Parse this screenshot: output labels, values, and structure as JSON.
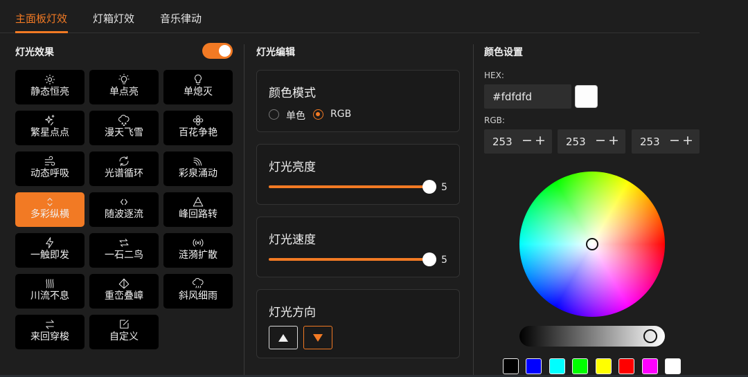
{
  "tabs": [
    {
      "label": "主面板灯效",
      "active": true
    },
    {
      "label": "灯箱灯效",
      "active": false
    },
    {
      "label": "音乐律动",
      "active": false
    }
  ],
  "effects_panel": {
    "title": "灯光效果",
    "toggle_on": true,
    "items": [
      {
        "label": "静态恒亮",
        "icon": "sun-icon"
      },
      {
        "label": "单点亮",
        "icon": "bulb-on-icon"
      },
      {
        "label": "单熄灭",
        "icon": "bulb-off-icon"
      },
      {
        "label": "繁星点点",
        "icon": "sparkle-icon"
      },
      {
        "label": "漫天飞雪",
        "icon": "snow-cloud-icon"
      },
      {
        "label": "百花争艳",
        "icon": "flower-icon"
      },
      {
        "label": "动态呼吸",
        "icon": "wind-icon"
      },
      {
        "label": "光谱循环",
        "icon": "cycle-icon"
      },
      {
        "label": "彩泉涌动",
        "icon": "rainbow-icon"
      },
      {
        "label": "多彩纵横",
        "icon": "chevrons-vertical-icon",
        "active": true
      },
      {
        "label": "随波逐流",
        "icon": "chevrons-horizontal-icon"
      },
      {
        "label": "峰回路转",
        "icon": "pyramid-icon"
      },
      {
        "label": "一触即发",
        "icon": "lightning-icon"
      },
      {
        "label": "一石二鸟",
        "icon": "split-arrows-icon"
      },
      {
        "label": "涟漪扩散",
        "icon": "broadcast-icon"
      },
      {
        "label": "川流不息",
        "icon": "waves-icon"
      },
      {
        "label": "重峦叠嶂",
        "icon": "mountains-icon"
      },
      {
        "label": "斜风细雨",
        "icon": "rain-cloud-icon"
      },
      {
        "label": "来回穿梭",
        "icon": "swap-arrows-icon"
      },
      {
        "label": "自定义",
        "icon": "edit-icon"
      }
    ]
  },
  "edit_panel": {
    "title": "灯光编辑",
    "color_mode": {
      "title": "颜色模式",
      "options": [
        {
          "label": "单色",
          "checked": false
        },
        {
          "label": "RGB",
          "checked": true
        }
      ]
    },
    "brightness": {
      "title": "灯光亮度",
      "value": 5,
      "max": 5
    },
    "speed": {
      "title": "灯光速度",
      "value": 5,
      "max": 5
    },
    "direction": {
      "title": "灯光方向",
      "selected": "down"
    }
  },
  "color_panel": {
    "title": "颜色设置",
    "hex_label": "HEX:",
    "hex_value": "#fdfdfd",
    "preview_color": "#fdfdfd",
    "rgb_label": "RGB:",
    "rgb": [
      253,
      253,
      253
    ],
    "minus": "−",
    "plus": "+",
    "brightness_level": 0.92,
    "presets": [
      "#000000",
      "#0000ff",
      "#00ffff",
      "#00ff00",
      "#ffff00",
      "#ff0000",
      "#ff00ff",
      "#ffffff"
    ]
  },
  "accent_color": "#f27a24"
}
